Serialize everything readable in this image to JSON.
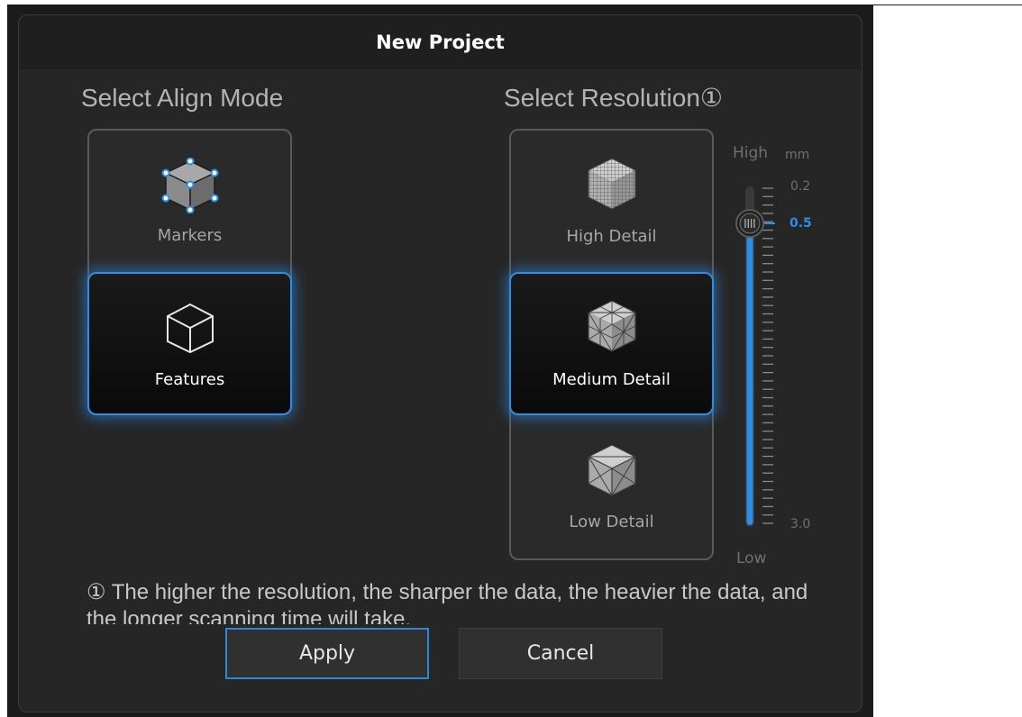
{
  "dialog": {
    "title": "New Project"
  },
  "align_mode": {
    "heading": "Select Align Mode",
    "options": [
      {
        "label": "Markers",
        "icon": "markers-cube-icon",
        "selected": false
      },
      {
        "label": "Features",
        "icon": "features-cube-icon",
        "selected": true
      }
    ]
  },
  "resolution": {
    "heading": "Select Resolution①",
    "options": [
      {
        "label": "High Detail",
        "icon": "high-detail-mesh-cube-icon",
        "selected": false
      },
      {
        "label": "Medium Detail",
        "icon": "medium-detail-mesh-cube-icon",
        "selected": true
      },
      {
        "label": "Low Detail",
        "icon": "low-detail-mesh-cube-icon",
        "selected": false
      }
    ]
  },
  "slider": {
    "high_label": "High",
    "unit": "mm",
    "min_value_label": "0.2",
    "current_value_label": "0.5",
    "max_value_label": "3.0",
    "low_label": "Low",
    "min": 0.2,
    "max": 3.0,
    "value": 0.5,
    "accent_color": "#2e8de6"
  },
  "note": {
    "text": "① The higher the resolution, the sharper the data, the heavier the data, and the longer scanning time will take."
  },
  "buttons": {
    "apply_label": "Apply",
    "cancel_label": "Cancel"
  },
  "colors": {
    "accent": "#2e8de6",
    "dialog_bg": "#262626",
    "titlebar_bg": "#1f1f1f"
  }
}
